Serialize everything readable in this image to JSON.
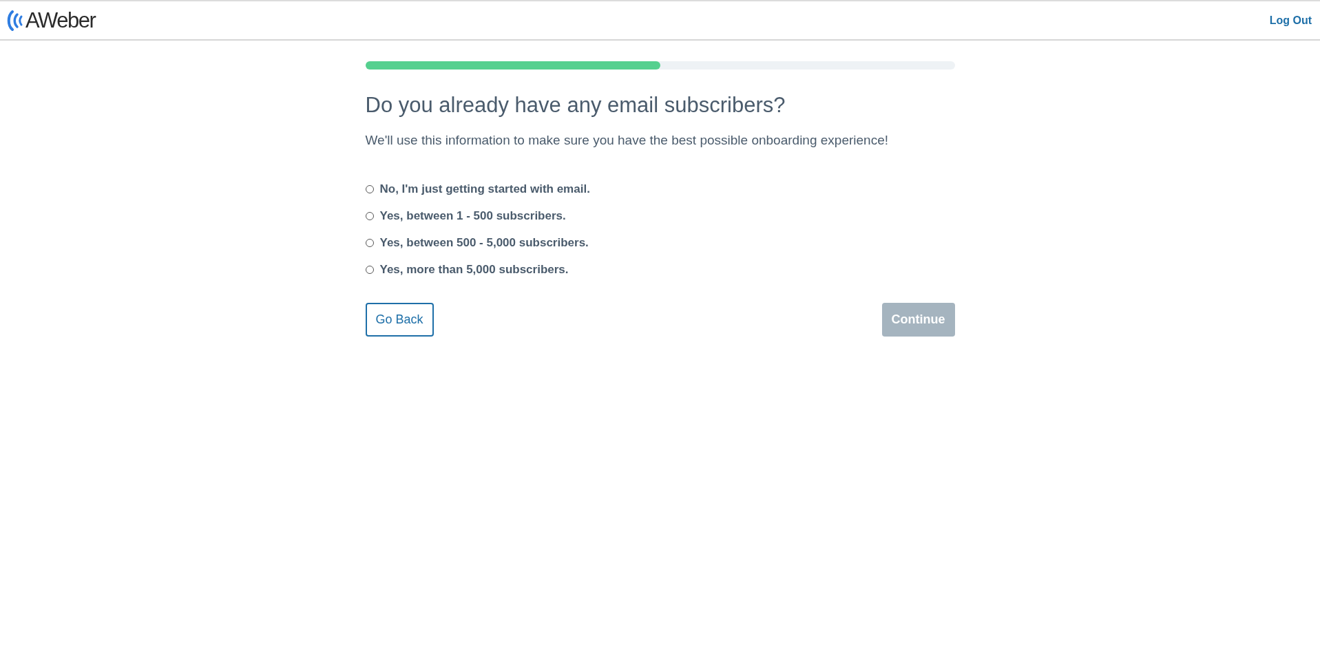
{
  "header": {
    "logo": "AWeber",
    "logout": "Log Out"
  },
  "progress": {
    "level": 0.5
  },
  "title": "Do you already have any email subscribers?",
  "subtitle": "We'll use this information to make sure you have the best possible onboarding experience!",
  "options": [
    {
      "label": "No, I'm just getting started with email.",
      "selected": false
    },
    {
      "label": "Yes, between 1 - 500 subscribers.",
      "selected": false
    },
    {
      "label": "Yes, between 500 - 5,000 subscribers.",
      "selected": false
    },
    {
      "label": "Yes, more than 5,000 subscribers.",
      "selected": false
    }
  ],
  "back_button": {
    "label": "Go Back"
  },
  "continue_button": {
    "label": "Continue",
    "disabled": true
  }
}
